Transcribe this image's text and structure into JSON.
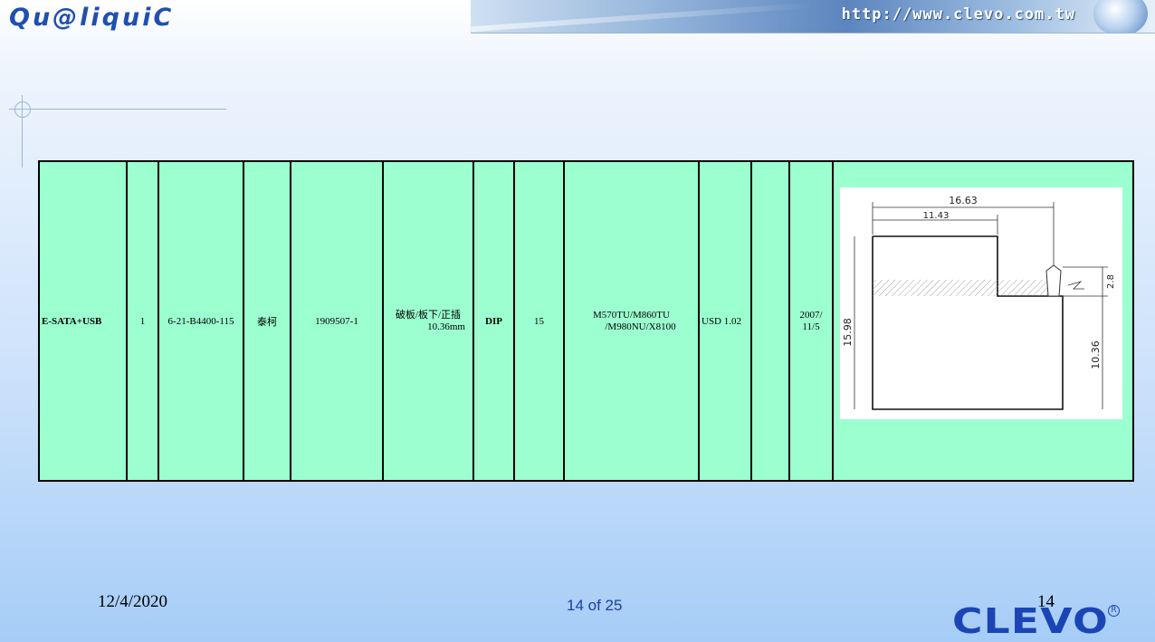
{
  "header": {
    "brand": "Qu@liquiC",
    "url": "http://www.clevo.com.tw"
  },
  "row": {
    "name": "E-SATA+USB",
    "qty": "1",
    "part_no": "6-21-B4400-115",
    "vendor": "泰柯",
    "vendor_part": "1909507-1",
    "mount": "破板/板下/正插",
    "mount_dim": "10.36mm",
    "type": "DIP",
    "count": "15",
    "models_line1": "M570TU/M860TU",
    "models_line2": "/M980NU/X8100",
    "price": "USD 1.02",
    "extra": "",
    "date_line1": "2007/",
    "date_line2": "11/5"
  },
  "drawing": {
    "dim_width": "16.63",
    "dim_step": "11.43",
    "dim_height": "15.98",
    "dim_offset": "2.8",
    "dim_lower": "10.36"
  },
  "footer": {
    "date": "12/4/2020",
    "page_of": "14 of 25",
    "page_num": "14",
    "logo": "CLEVO",
    "reg_mark": "R"
  },
  "colors": {
    "table_bg": "#9bffd0",
    "accent_blue": "#1b45b5",
    "date_red": "#d11c1c"
  }
}
